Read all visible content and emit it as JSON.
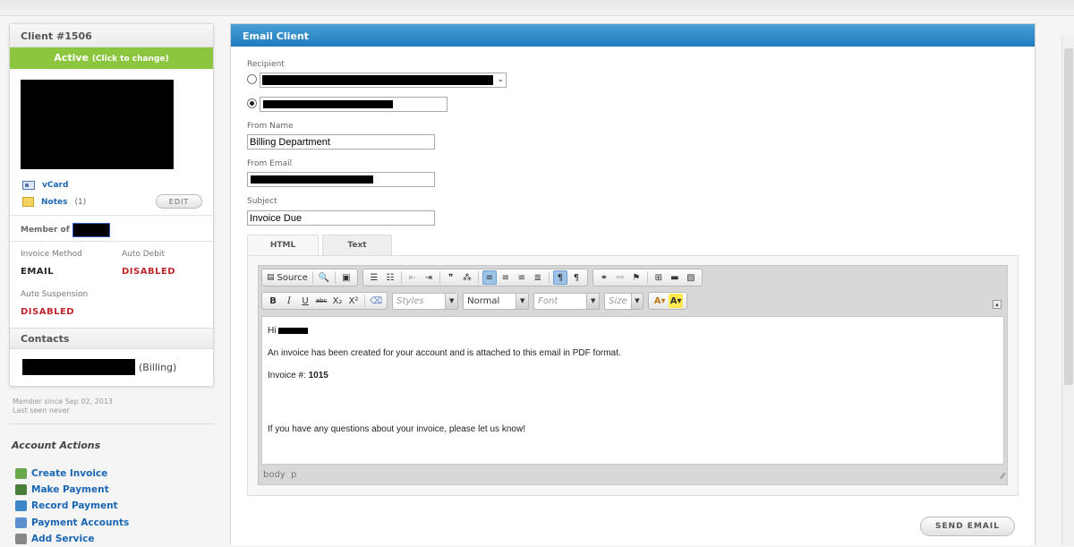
{
  "client": {
    "title": "Client #1506",
    "status": "Active",
    "status_hint": "(Click to change)",
    "vcard_label": "vCard",
    "notes_label": "Notes",
    "notes_count": "(1)",
    "edit_label": "EDIT",
    "member_of_label": "Member of",
    "invoice_method_label": "Invoice Method",
    "invoice_method_value": "EMAIL",
    "auto_debit_label": "Auto Debit",
    "auto_debit_value": "DISABLED",
    "auto_suspension_label": "Auto Suspension",
    "auto_suspension_value": "DISABLED",
    "contacts_title": "Contacts",
    "contact_role": "(Billing)",
    "member_since": "Member since Sep 02, 2013",
    "last_seen": "Last seen never"
  },
  "actions": {
    "title": "Account Actions",
    "items": [
      {
        "label": "Create Invoice",
        "icon": "create-invoice-icon",
        "color": "#6aa84f"
      },
      {
        "label": "Make Payment",
        "icon": "make-payment-icon",
        "color": "#4a7f3a"
      },
      {
        "label": "Record Payment",
        "icon": "record-payment-icon",
        "color": "#3d85c6"
      },
      {
        "label": "Payment Accounts",
        "icon": "payment-accounts-icon",
        "color": "#5b8fd0"
      },
      {
        "label": "Add Service",
        "icon": "add-service-icon",
        "color": "#888888"
      }
    ]
  },
  "email": {
    "panel_title": "Email Client",
    "recipient_label": "Recipient",
    "from_name_label": "From Name",
    "from_name_value": "Billing Department",
    "from_email_label": "From Email",
    "subject_label": "Subject",
    "subject_value": "Invoice Due",
    "tabs": {
      "html": "HTML",
      "text": "Text"
    },
    "send_label": "SEND EMAIL"
  },
  "editor": {
    "source_label": "Source",
    "styles_placeholder": "Styles",
    "format_value": "Normal",
    "font_placeholder": "Font",
    "size_placeholder": "Size",
    "bold": "B",
    "italic": "I",
    "underline": "U",
    "strike": "abc",
    "sub": "X₂",
    "sup": "X²",
    "greeting": "Hi",
    "line1": "An invoice has been created for your account and is attached to this email in PDF format.",
    "invoice_label": "Invoice #:",
    "invoice_number": "1015",
    "line_questions": "If you have any questions about your invoice, please let us know!",
    "path_body": "body",
    "path_p": "p"
  },
  "colors": {
    "active_green": "#8cc63f",
    "header_blue": "#1f7bbf",
    "disabled_red": "#c0272d",
    "link_blue": "#1a66b3"
  }
}
